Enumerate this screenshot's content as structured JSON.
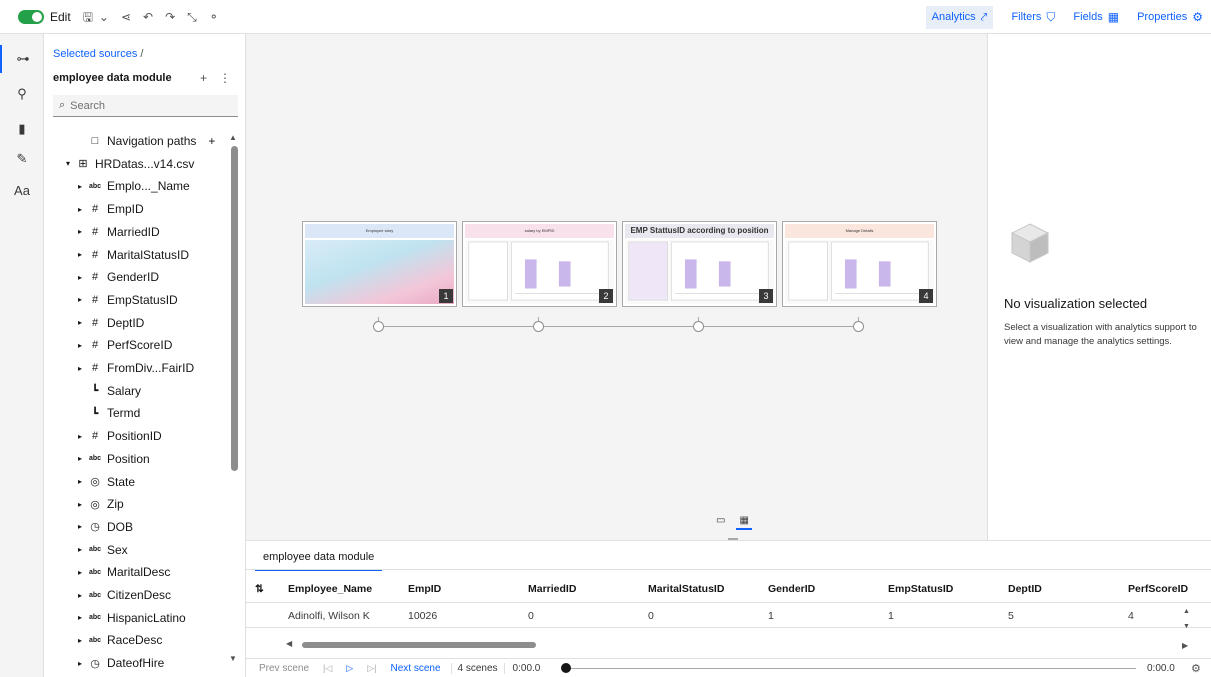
{
  "toolbar": {
    "edit_label": "Edit",
    "icons": [
      "save-icon",
      "chevron-down-icon",
      "share-icon",
      "undo-icon",
      "redo-icon",
      "auto-fit-icon",
      "pointer-icon"
    ],
    "right_items": [
      {
        "label": "Analytics",
        "icon": "analytics-icon",
        "glyph": "⤤",
        "active": true
      },
      {
        "label": "Filters",
        "icon": "filter-icon",
        "glyph": "⛉",
        "active": false
      },
      {
        "label": "Fields",
        "icon": "fields-icon",
        "glyph": "▦",
        "active": false
      },
      {
        "label": "Properties",
        "icon": "properties-icon",
        "glyph": "⚙",
        "active": false
      }
    ]
  },
  "rail": {
    "items": [
      {
        "icon": "data-sources-icon",
        "glyph": "⊶",
        "active": true
      },
      {
        "icon": "pin-icon",
        "glyph": "⚲",
        "active": false
      },
      {
        "icon": "visualizations-icon",
        "glyph": "▮",
        "active": false
      },
      {
        "icon": "insights-icon",
        "glyph": "✎",
        "active": false
      },
      {
        "icon": "text-icon",
        "glyph": "Aa",
        "active": false
      }
    ]
  },
  "source": {
    "breadcrumb": "Selected sources",
    "breadcrumb_sep": "/",
    "module_title": "employee data module",
    "add_glyph": "+",
    "more_glyph": "⋮",
    "search_placeholder": "Search",
    "tree": [
      {
        "label": "Navigation paths",
        "type": "folder",
        "glyph": "□",
        "caret": "",
        "extra": "+"
      },
      {
        "label": "HRDatas...v14.csv",
        "type": "table",
        "glyph": "⊞",
        "caret": "▾"
      },
      {
        "label": "Emplo..._Name",
        "type": "abc",
        "glyph": "abc",
        "caret": "▸"
      },
      {
        "label": "EmpID",
        "type": "num",
        "glyph": "#",
        "caret": "▸"
      },
      {
        "label": "MarriedID",
        "type": "num",
        "glyph": "#",
        "caret": "▸"
      },
      {
        "label": "MaritalStatusID",
        "type": "num",
        "glyph": "#",
        "caret": "▸"
      },
      {
        "label": "GenderID",
        "type": "num",
        "glyph": "#",
        "caret": "▸"
      },
      {
        "label": "EmpStatusID",
        "type": "num",
        "glyph": "#",
        "caret": "▸"
      },
      {
        "label": "DeptID",
        "type": "num",
        "glyph": "#",
        "caret": "▸"
      },
      {
        "label": "PerfScoreID",
        "type": "num",
        "glyph": "#",
        "caret": "▸"
      },
      {
        "label": "FromDiv...FairID",
        "type": "num",
        "glyph": "#",
        "caret": "▸"
      },
      {
        "label": "Salary",
        "type": "measure",
        "glyph": "┗",
        "caret": ""
      },
      {
        "label": "Termd",
        "type": "measure",
        "glyph": "┗",
        "caret": ""
      },
      {
        "label": "PositionID",
        "type": "num",
        "glyph": "#",
        "caret": "▸"
      },
      {
        "label": "Position",
        "type": "abc",
        "glyph": "abc",
        "caret": "▸"
      },
      {
        "label": "State",
        "type": "geo",
        "glyph": "◎",
        "caret": "▸"
      },
      {
        "label": "Zip",
        "type": "geo",
        "glyph": "◎",
        "caret": "▸"
      },
      {
        "label": "DOB",
        "type": "time",
        "glyph": "◷",
        "caret": "▸"
      },
      {
        "label": "Sex",
        "type": "abc",
        "glyph": "abc",
        "caret": "▸"
      },
      {
        "label": "MaritalDesc",
        "type": "abc",
        "glyph": "abc",
        "caret": "▸"
      },
      {
        "label": "CitizenDesc",
        "type": "abc",
        "glyph": "abc",
        "caret": "▸"
      },
      {
        "label": "HispanicLatino",
        "type": "abc",
        "glyph": "abc",
        "caret": "▸"
      },
      {
        "label": "RaceDesc",
        "type": "abc",
        "glyph": "abc",
        "caret": "▸"
      },
      {
        "label": "DateofHire",
        "type": "time",
        "glyph": "◷",
        "caret": "▸"
      }
    ]
  },
  "canvas": {
    "scenes": [
      {
        "title": "Employee story",
        "number": "1",
        "header_color": "#dbe6f7"
      },
      {
        "title": "salary by EMPID",
        "number": "2",
        "header_color": "#f9e1ec"
      },
      {
        "title": "EMP StattusID according to position",
        "number": "3",
        "header_color": "#e8e8ee"
      },
      {
        "title": "Manage Details",
        "number": "4",
        "header_color": "#fbe6dd"
      }
    ],
    "view_toggle": [
      {
        "icon": "page-view-icon",
        "glyph": "▭",
        "active": false
      },
      {
        "icon": "grid-view-icon",
        "glyph": "▦",
        "active": true
      }
    ]
  },
  "right_panel": {
    "title": "No visualization selected",
    "description": "Select a visualization with analytics support to view and manage the analytics settings."
  },
  "grid": {
    "tab": "employee data module",
    "sort_glyph": "⇅",
    "columns": [
      "Employee_Name",
      "EmpID",
      "MarriedID",
      "MaritalStatusID",
      "GenderID",
      "EmpStatusID",
      "DeptID",
      "PerfScoreID"
    ],
    "rows": [
      [
        "Adinolfi, Wilson K",
        "10026",
        "0",
        "0",
        "1",
        "1",
        "5",
        "4"
      ]
    ]
  },
  "scene_bar": {
    "prev_label": "Prev scene",
    "next_label": "Next scene",
    "count": "4 scenes",
    "start_time": "0:00.0",
    "end_time": "0:00.0"
  }
}
